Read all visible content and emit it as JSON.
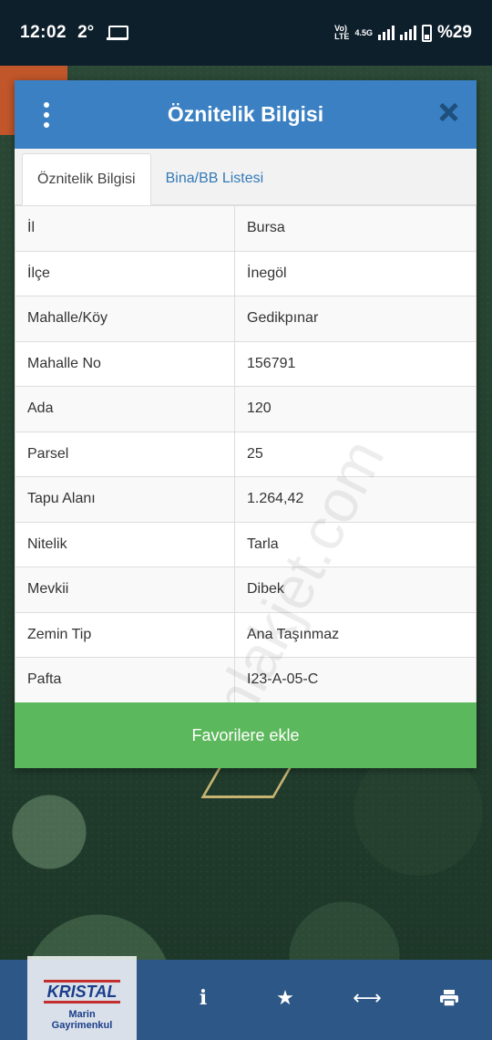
{
  "status_bar": {
    "time": "12:02",
    "temperature": "2°",
    "network": "4.5G",
    "battery": "%29"
  },
  "modal": {
    "title": "Öznitelik Bilgisi",
    "tabs": [
      {
        "label": "Öznitelik Bilgisi",
        "active": true
      },
      {
        "label": "Bina/BB Listesi",
        "active": false
      }
    ],
    "rows": [
      {
        "key": "İl",
        "value": "Bursa"
      },
      {
        "key": "İlçe",
        "value": "İnegöl"
      },
      {
        "key": "Mahalle/Köy",
        "value": "Gedikpınar"
      },
      {
        "key": "Mahalle No",
        "value": "156791"
      },
      {
        "key": "Ada",
        "value": "120"
      },
      {
        "key": "Parsel",
        "value": "25"
      },
      {
        "key": "Tapu Alanı",
        "value": "1.264,42"
      },
      {
        "key": "Nitelik",
        "value": "Tarla"
      },
      {
        "key": "Mevkii",
        "value": "Dibek"
      },
      {
        "key": "Zemin Tip",
        "value": "Ana Taşınmaz"
      },
      {
        "key": "Pafta",
        "value": "I23-A-05-C"
      }
    ],
    "favorite_button": "Favorilere ekle"
  },
  "watermark": "emlakjet.com",
  "logo": {
    "brand": "KRISTAL",
    "sub_line1": "Marin",
    "sub_line2": "Gayrimenkul"
  },
  "toolbar": {
    "icons": [
      "info-icon",
      "star-icon",
      "measure-icon",
      "print-icon"
    ]
  },
  "colors": {
    "header": "#3a80c3",
    "button": "#5cb85c",
    "toolbar": "#2d5787",
    "status_bar": "#0e1f2c"
  }
}
